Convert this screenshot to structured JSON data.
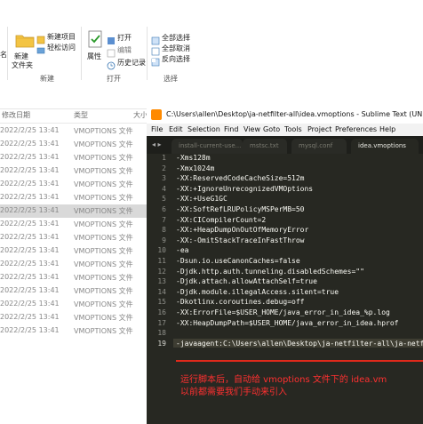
{
  "ribbon": {
    "new_item": "新建项目",
    "easy_access": "轻松访问",
    "new_folder_line1": "新建",
    "new_folder_line2": "文件夹",
    "new_group": "新建",
    "properties": "属性",
    "open": "打开",
    "edit": "编辑",
    "history": "历史记录",
    "open_group": "打开",
    "select_all": "全部选择",
    "select_none": "全部取消",
    "invert_selection": "反向选择",
    "select_group": "选择",
    "left_partial_label": "名"
  },
  "explorer": {
    "col_date": "修改日期",
    "col_type": "类型",
    "col_size": "大小",
    "rows": [
      {
        "date": "2022/2/25 13:41",
        "type": "VMOPTIONS 文件"
      },
      {
        "date": "2022/2/25 13:41",
        "type": "VMOPTIONS 文件"
      },
      {
        "date": "2022/2/25 13:41",
        "type": "VMOPTIONS 文件"
      },
      {
        "date": "2022/2/25 13:41",
        "type": "VMOPTIONS 文件"
      },
      {
        "date": "2022/2/25 13:41",
        "type": "VMOPTIONS 文件"
      },
      {
        "date": "2022/2/25 13:41",
        "type": "VMOPTIONS 文件"
      },
      {
        "date": "2022/2/25 13:41",
        "type": "VMOPTIONS 文件"
      },
      {
        "date": "2022/2/25 13:41",
        "type": "VMOPTIONS 文件"
      },
      {
        "date": "2022/2/25 13:41",
        "type": "VMOPTIONS 文件"
      },
      {
        "date": "2022/2/25 13:41",
        "type": "VMOPTIONS 文件"
      },
      {
        "date": "2022/2/25 13:41",
        "type": "VMOPTIONS 文件"
      },
      {
        "date": "2022/2/25 13:41",
        "type": "VMOPTIONS 文件"
      },
      {
        "date": "2022/2/25 13:41",
        "type": "VMOPTIONS 文件"
      },
      {
        "date": "2022/2/25 13:41",
        "type": "VMOPTIONS 文件"
      },
      {
        "date": "2022/2/25 13:41",
        "type": "VMOPTIONS 文件"
      },
      {
        "date": "2022/2/25 13:41",
        "type": "VMOPTIONS 文件"
      }
    ]
  },
  "sublime": {
    "title": "C:\\Users\\allen\\Desktop\\ja-netfilter-all\\idea.vmoptions - Sublime Text (UNRE",
    "menu": [
      "File",
      "Edit",
      "Selection",
      "Find",
      "View",
      "Goto",
      "Tools",
      "Project",
      "Preferences",
      "Help"
    ],
    "tabs": [
      "install-current-use...",
      "mstsc.txt",
      "mysql.conf",
      "idea.vmoptions"
    ],
    "lines": [
      "-Xms128m",
      "-Xmx1024m",
      "-XX:ReservedCodeCacheSize=512m",
      "-XX:+IgnoreUnrecognizedVMOptions",
      "-XX:+UseG1GC",
      "-XX:SoftRefLRUPolicyMSPerMB=50",
      "-XX:CICompilerCount=2",
      "-XX:+HeapDumpOnOutOfMemoryError",
      "-XX:-OmitStackTraceInFastThrow",
      "-ea",
      "-Dsun.io.useCanonCaches=false",
      "-Djdk.http.auth.tunneling.disabledSchemes=\"\"",
      "-Djdk.attach.allowAttachSelf=true",
      "-Djdk.module.illegalAccess.silent=true",
      "-Dkotlinx.coroutines.debug=off",
      "-XX:ErrorFile=$USER_HOME/java_error_in_idea_%p.log",
      "-XX:HeapDumpPath=$USER_HOME/java_error_in_idea.hprof",
      "",
      "-javaagent:C:\\Users\\allen\\Desktop\\ja-netfilter-all\\ja-netfi"
    ],
    "line_numbers": [
      "1",
      "2",
      "3",
      "4",
      "5",
      "6",
      "7",
      "8",
      "9",
      "10",
      "11",
      "12",
      "13",
      "14",
      "15",
      "16",
      "17",
      "18",
      "19"
    ]
  },
  "annotation": {
    "line1": "运行脚本后，自动给 vmoptions 文件下的 idea.vm",
    "line2": "以前都需要我们手动来引入",
    "color": "#ff3030"
  }
}
